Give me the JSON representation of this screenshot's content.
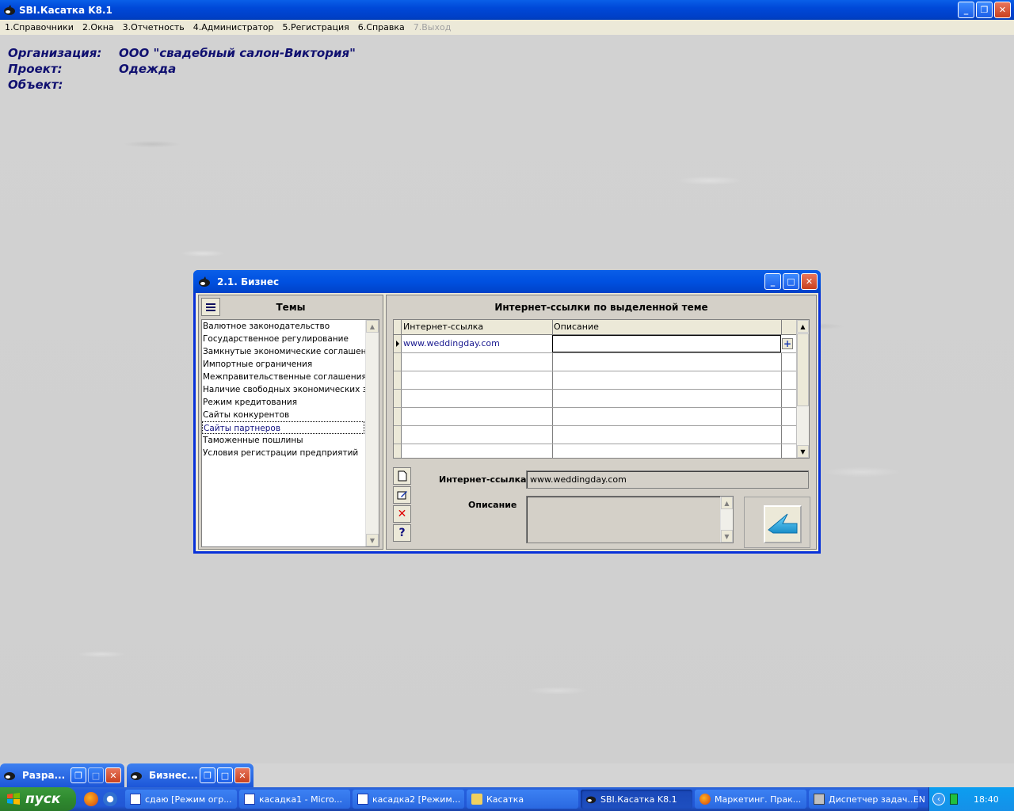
{
  "app": {
    "title": "SBI.Касатка K8.1"
  },
  "menu": [
    {
      "label": "1.Справочники",
      "disabled": false
    },
    {
      "label": "2.Окна",
      "disabled": false
    },
    {
      "label": "3.Отчетность",
      "disabled": false
    },
    {
      "label": "4.Администратор",
      "disabled": false
    },
    {
      "label": "5.Регистрация",
      "disabled": false
    },
    {
      "label": "6.Справка",
      "disabled": false
    },
    {
      "label": "7.Выход",
      "disabled": true
    }
  ],
  "info": {
    "org_label": "Организация:",
    "org_value": "ООО \"свадебный салон-Виктория\"",
    "project_label": "Проект:",
    "project_value": "Одежда",
    "object_label": "Объект:",
    "object_value": ""
  },
  "dialog": {
    "title": "2.1. Бизнес",
    "topics_title": "Темы",
    "topics": [
      "Валютное законодательство",
      "Государственное регулирование",
      "Замкнутые экономические соглашения",
      "Импортные ограничения",
      "Межправительственные соглашения",
      "Наличие свободных экономических зон",
      "Режим кредитования",
      "Сайты конкурентов",
      "Сайты партнеров",
      "Таможенные пошлины",
      "Условия регистрации предприятий"
    ],
    "selected_topic_index": 8,
    "links_title": "Интернет-ссылки по выделенной теме",
    "grid_headers": [
      "Интернет-ссылка",
      "Описание"
    ],
    "grid_rows": [
      {
        "link": "www.weddingday.com",
        "description": ""
      }
    ],
    "link_label": "Интернет-ссылка",
    "link_value": "www.weddingday.com",
    "description_label": "Описание",
    "description_value": ""
  },
  "minimized": [
    {
      "label": "Разра..."
    },
    {
      "label": "Бизнес..."
    }
  ],
  "taskbar": {
    "start_label": "пуск",
    "tasks": [
      {
        "label": "сдаю [Режим огр...",
        "active": false
      },
      {
        "label": "касадка1 - Micro...",
        "active": false
      },
      {
        "label": "касадка2 [Режим...",
        "active": false
      },
      {
        "label": "Касатка",
        "active": false
      },
      {
        "label": "SBI.Касатка K8.1",
        "active": true
      },
      {
        "label": "Маркетинг. Прак...",
        "active": false
      },
      {
        "label": "Диспетчер задач...",
        "active": false
      }
    ],
    "lang": "EN",
    "clock": "18:40"
  },
  "colors": {
    "titlebar": "#0048d8",
    "info_text": "#101070",
    "dialog_border": "#0831d9",
    "start_green": "#2f8a2f"
  }
}
